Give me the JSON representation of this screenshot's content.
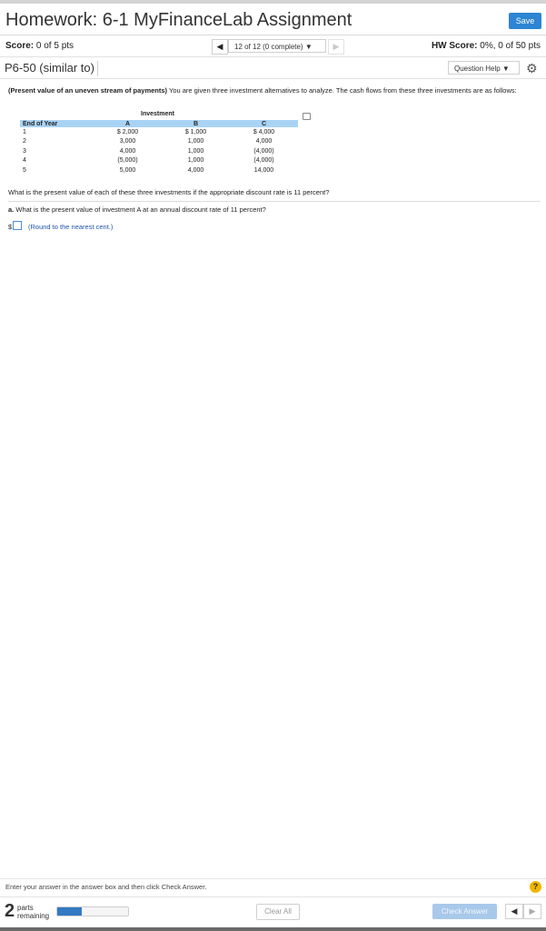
{
  "header": {
    "title": "Homework: 6-1 MyFinanceLab Assignment",
    "save_label": "Save"
  },
  "scorebar": {
    "score_label": "Score:",
    "score_value": "0 of 5 pts",
    "nav_prev_glyph": "◀",
    "nav_selector": "12 of 12 (0 complete) ▼",
    "nav_next_glyph": "▶",
    "hw_score_label": "HW Score:",
    "hw_score_value": "0%, 0 of 50 pts"
  },
  "question_bar": {
    "title": "P6-50 (similar to)",
    "help_label": "Question Help ▼",
    "settings_icon": "gear-icon"
  },
  "problem": {
    "bold_intro": "(Present value of an uneven stream of payments)",
    "text": "You are given three investment alternatives to analyze. The cash flows from these three investments are as follows:"
  },
  "table": {
    "group_header": "Investment",
    "headers": [
      "End of Year",
      "A",
      "B",
      "C"
    ],
    "rows": [
      [
        "1",
        "$ 2,000",
        "$ 1,000",
        "$ 4,000"
      ],
      [
        "2",
        "3,000",
        "1,000",
        "4,000"
      ],
      [
        "3",
        "4,000",
        "1,000",
        "(4,000)"
      ],
      [
        "4",
        "(5,000)",
        "1,000",
        "(4,000)"
      ],
      [
        "5",
        "5,000",
        "4,000",
        "14,000"
      ]
    ]
  },
  "question": {
    "text": "What is the present value of each of these three investments if the appropriate discount rate is 11 percent?"
  },
  "part_a": {
    "label": "a.",
    "text": "What is the present value of investment A at an annual discount rate of 11 percent?",
    "currency": "$",
    "answer_value": "",
    "round_note": "(Round to the nearest cent.)"
  },
  "footer": {
    "instruction": "Enter your answer in the answer box and then click Check Answer.",
    "help_glyph": "?",
    "parts_count": "2",
    "parts_label_1": "parts",
    "parts_label_2": "remaining",
    "progress_fraction": 0.35,
    "clear_label": "Clear All",
    "check_label": "Check Answer",
    "prev_glyph": "◀",
    "next_glyph": "▶"
  },
  "colors": {
    "save_button": "#2d85d3",
    "table_header": "#a9d3f5",
    "progress_fill": "#3379c3",
    "check_button": "#a8c9ea",
    "help_icon": "#f1b600"
  }
}
